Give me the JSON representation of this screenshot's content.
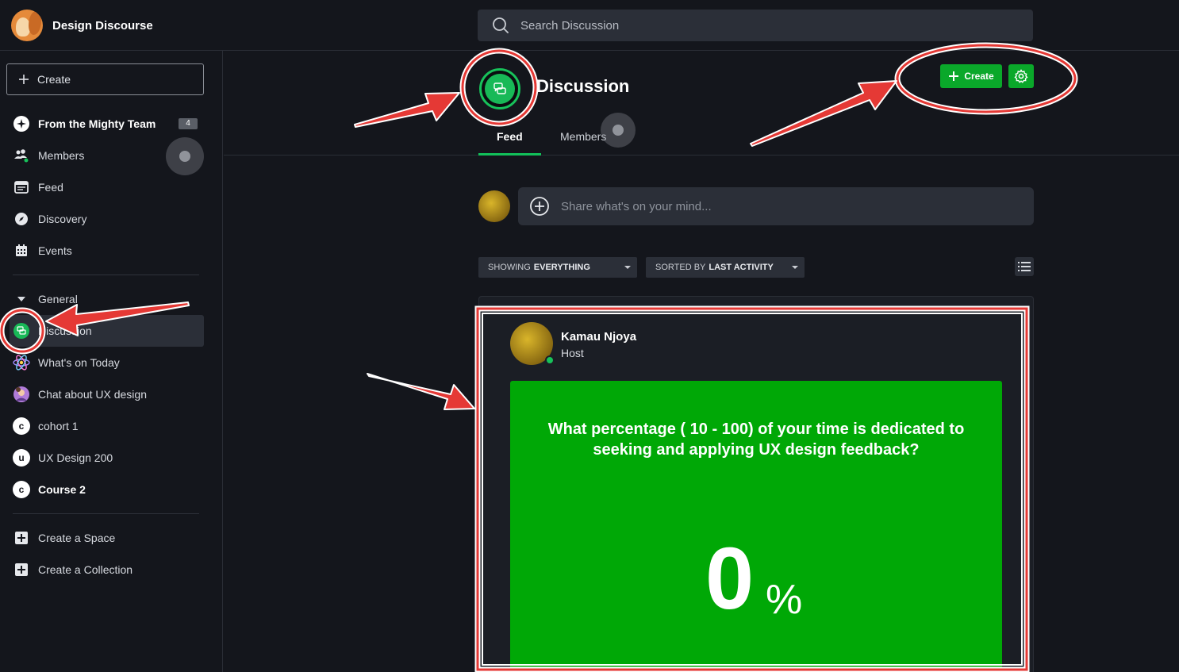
{
  "app": {
    "name": "Design Discourse"
  },
  "search": {
    "placeholder": "Search Discussion"
  },
  "sidebar": {
    "create_label": "Create",
    "items": [
      {
        "label": "From the Mighty Team",
        "badge": "4",
        "icon": "sparkle-icon"
      },
      {
        "label": "Members",
        "icon": "members-icon"
      },
      {
        "label": "Feed",
        "icon": "feed-icon"
      },
      {
        "label": "Discovery",
        "icon": "compass-icon"
      },
      {
        "label": "Events",
        "icon": "calendar-icon"
      }
    ],
    "section": "General",
    "spaces": [
      {
        "label": "Discussion",
        "icon": "chat-bubbles-icon"
      },
      {
        "label": "What's on Today",
        "icon": "atom-icon"
      },
      {
        "label": "Chat about UX design",
        "icon": "avatar-image"
      },
      {
        "label": "cohort 1",
        "letter": "c"
      },
      {
        "label": "UX Design 200",
        "letter": "u"
      },
      {
        "label": "Course 2",
        "letter": "c"
      }
    ],
    "actions": [
      {
        "label": "Create a Space",
        "icon": "plus-square-icon"
      },
      {
        "label": "Create a Collection",
        "icon": "plus-square-icon"
      }
    ]
  },
  "header": {
    "title": "Discussion",
    "create_label": "Create",
    "tabs": [
      {
        "label": "Feed",
        "active": true
      },
      {
        "label": "Members",
        "active": false
      }
    ]
  },
  "composer": {
    "placeholder": "Share what's on your mind..."
  },
  "filters": {
    "showing_prefix": "SHOWING",
    "showing_value": "EVERYTHING",
    "sorted_prefix": "SORTED BY",
    "sorted_value": "LAST ACTIVITY"
  },
  "post": {
    "author": "Kamau Njoya",
    "role": "Host",
    "poll_question": "What percentage ( 10 - 100) of your time is dedicated to seeking and applying UX design feedback?",
    "poll_value": "0",
    "poll_unit": "%"
  },
  "colors": {
    "accent": "#0aa82a",
    "poll_bg": "#00a806",
    "annotation": "#e53935",
    "bg": "#14161c"
  }
}
